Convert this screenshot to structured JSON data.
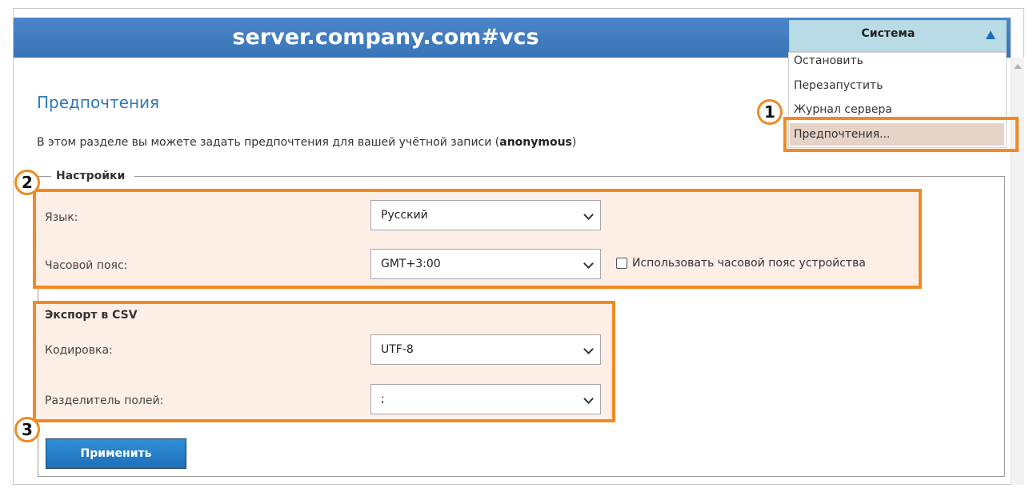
{
  "header": {
    "title": "server.company.com#vcs"
  },
  "page": {
    "title": "Предпочтения",
    "description_prefix": "В этом разделе вы можете задать предпочтения для вашей учётной записи (",
    "description_user": "anonymous",
    "description_suffix": ")"
  },
  "settings": {
    "legend": "Настройки",
    "language_label": "Язык:",
    "language_value": "Русский",
    "timezone_label": "Часовой пояс:",
    "timezone_value": "GMT+3:00",
    "use_device_tz_label": "Использовать часовой пояс устройства"
  },
  "csv_export": {
    "title": "Экспорт в CSV",
    "encoding_label": "Кодировка:",
    "encoding_value": "UTF-8",
    "separator_label": "Разделитель полей:",
    "separator_value": ";"
  },
  "apply_button": "Применить",
  "system_menu": {
    "title": "Система",
    "items": [
      "Остановить",
      "Перезапустить",
      "Журнал сервера",
      "Предпочтения..."
    ],
    "selected_index": 3
  },
  "callouts": [
    "1",
    "2",
    "3"
  ],
  "colors": {
    "accent": "#f08a24",
    "header": "#3a74b8",
    "link": "#2f7ab8"
  }
}
